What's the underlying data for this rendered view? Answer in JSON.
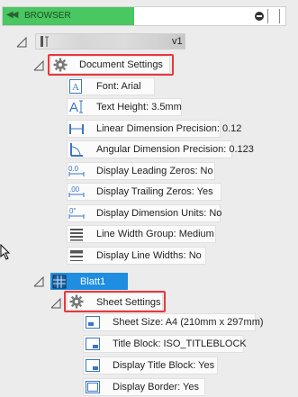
{
  "browser": {
    "title": "BROWSER"
  },
  "document": {
    "version": "v1"
  },
  "document_settings": {
    "label": "Document Settings",
    "items": [
      {
        "icon": "font-icon",
        "label": "Font: Arial"
      },
      {
        "icon": "text-height-icon",
        "label": "Text Height: 3.5mm"
      },
      {
        "icon": "linear-dimension-icon",
        "label": "Linear Dimension Precision: 0.12"
      },
      {
        "icon": "angular-dimension-icon",
        "label": "Angular Dimension Precision: 0.123"
      },
      {
        "icon": "leading-zeros-icon",
        "label": "Display Leading Zeros: No"
      },
      {
        "icon": "trailing-zeros-icon",
        "label": "Display Trailing Zeros: Yes"
      },
      {
        "icon": "dimension-units-icon",
        "label": "Display Dimension Units: No"
      },
      {
        "icon": "line-width-group-icon",
        "label": "Line Width Group: Medium"
      },
      {
        "icon": "line-widths-icon",
        "label": "Display Line Widths: No"
      }
    ]
  },
  "sheet": {
    "label": "Blatt1"
  },
  "sheet_settings": {
    "label": "Sheet Settings",
    "items": [
      {
        "icon": "sheet-size-icon",
        "label": "Sheet Size: A4 (210mm x 297mm)"
      },
      {
        "icon": "title-block-icon",
        "label": "Title Block: ISO_TITLEBLOCK"
      },
      {
        "icon": "display-title-block-icon",
        "label": "Display Title Block: Yes"
      },
      {
        "icon": "display-border-icon",
        "label": "Display Border: Yes"
      }
    ]
  },
  "colors": {
    "accent": "#49c760",
    "highlight": "#e8383d",
    "selection": "#1f8ee0"
  }
}
